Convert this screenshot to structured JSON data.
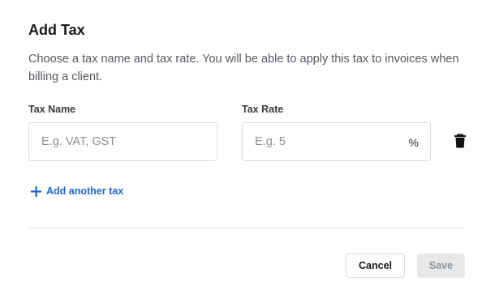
{
  "dialog": {
    "title": "Add Tax",
    "description": "Choose a tax name and tax rate. You will be able to apply this tax to invoices when billing a client."
  },
  "fields": {
    "tax_name": {
      "label": "Tax Name",
      "value": "",
      "placeholder": "E.g. VAT, GST"
    },
    "tax_rate": {
      "label": "Tax Rate",
      "value": "",
      "placeholder": "E.g. 5",
      "suffix": "%"
    }
  },
  "row_actions": {
    "delete_icon": "trash-icon"
  },
  "add_another": {
    "icon": "plus-icon",
    "label": "Add another tax"
  },
  "footer": {
    "cancel_label": "Cancel",
    "save_label": "Save"
  },
  "colors": {
    "link": "#1f66c9",
    "save_disabled_bg": "#e6e8ea",
    "save_disabled_text": "#8e9398"
  }
}
